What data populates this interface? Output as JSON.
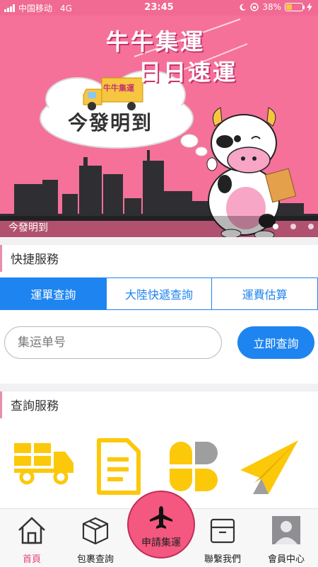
{
  "status_bar": {
    "carrier": "中国移动",
    "network": "4G",
    "time": "23:45",
    "battery": "38%",
    "battery_level": 0.38
  },
  "banner": {
    "slogan_line1": "牛牛集運",
    "slogan_line2": "日日速運",
    "truck_sign": "牛牛集運",
    "cloud_text": "今發明到",
    "caption": "今發明到",
    "slide_count": 3,
    "active_slide": 1
  },
  "quick_services": {
    "title": "快捷服務",
    "tabs": [
      {
        "label": "運單查詢",
        "active": true
      },
      {
        "label": "大陸快遞查詢",
        "active": false
      },
      {
        "label": "運費估算",
        "active": false
      }
    ],
    "search": {
      "placeholder": "集运单号",
      "value": "",
      "button_label": "立即查詢"
    }
  },
  "query_services": {
    "title": "查詢服務",
    "items": [
      {
        "icon": "truck-icon"
      },
      {
        "icon": "document-icon"
      },
      {
        "icon": "grid-icon"
      },
      {
        "icon": "paper-plane-icon"
      }
    ]
  },
  "bottom_nav": {
    "items": [
      {
        "label": "首頁",
        "icon": "home-icon",
        "active": true
      },
      {
        "label": "包裹查詢",
        "icon": "package-icon",
        "active": false
      },
      {
        "label": "申請集運",
        "icon": "airplane-icon",
        "active": false
      },
      {
        "label": "聯繫我們",
        "icon": "box-icon",
        "active": false
      },
      {
        "label": "會員中心",
        "icon": "avatar-icon",
        "active": false
      }
    ]
  },
  "colors": {
    "brand_pink": "#f5719a",
    "accent_blue": "#1e84f0",
    "icon_yellow": "#fcc80a",
    "active_nav": "#e8437b"
  }
}
